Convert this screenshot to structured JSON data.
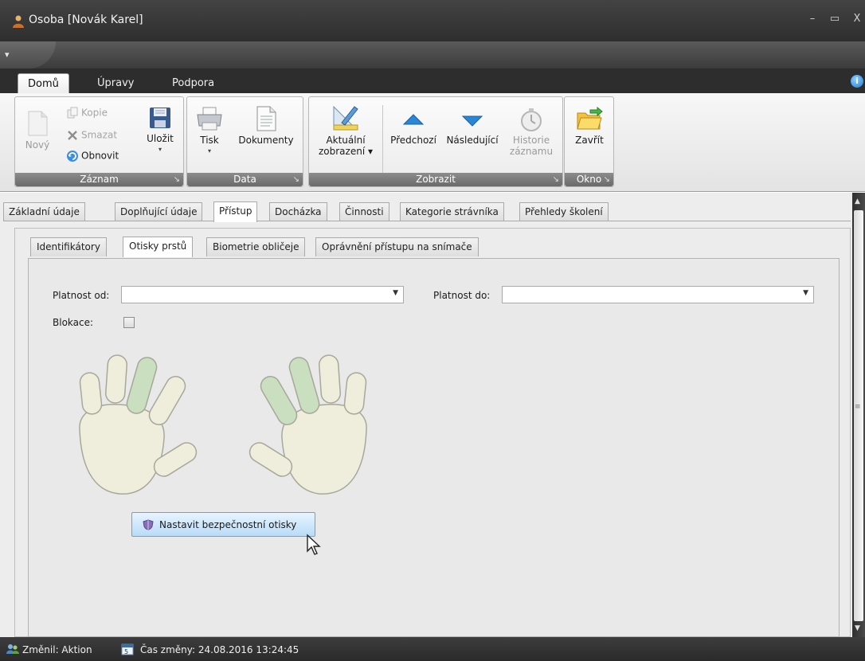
{
  "window": {
    "title": "Osoba [Novák Karel]",
    "minimize": "–",
    "maximize": "▭",
    "close": "X"
  },
  "quick_access": {
    "arrow": "▾"
  },
  "ribbon_tabs": [
    "Domů",
    "Úpravy",
    "Podpora"
  ],
  "info_icon": "i",
  "ribbon": {
    "zaznam": {
      "caption": "Záznam",
      "novy": "Nový",
      "kopie": "Kopie",
      "smazat": "Smazat",
      "obnovit": "Obnovit",
      "ulozit": "Uložit"
    },
    "data": {
      "caption": "Data",
      "tisk": "Tisk",
      "dokumenty": "Dokumenty"
    },
    "zobrazit": {
      "caption": "Zobrazit",
      "aktualni_line1": "Aktuální",
      "aktualni_line2": "zobrazení ▾",
      "predchozi": "Předchozí",
      "nasledujici": "Následující",
      "historie_line1": "Historie",
      "historie_line2": "záznamu"
    },
    "okno": {
      "caption": "Okno",
      "zavrit": "Zavřít"
    },
    "launcher_glyph": "↘"
  },
  "main_tabs": [
    "Základní údaje",
    "Doplňující údaje",
    "Přístup",
    "Docházka",
    "Činnosti",
    "Kategorie strávníka",
    "Přehledy školení"
  ],
  "sub_tabs": [
    "Identifikátory",
    "Otisky prstů",
    "Biometrie obličeje",
    "Oprávnění přístupu na snímače"
  ],
  "form": {
    "platnost_od_label": "Platnost od:",
    "platnost_od_value": "",
    "platnost_do_label": "Platnost do:",
    "platnost_do_value": "",
    "blokace_label": "Blokace:",
    "blokace_checked": false,
    "dropdown_arrow": "▼"
  },
  "fingers": {
    "left_hand_selected": [
      "middle"
    ],
    "right_hand_selected": [
      "index",
      "middle"
    ],
    "colors": {
      "unselected": "#efeedd",
      "selected": "#c9dfc0",
      "outline": "#a8a89a"
    }
  },
  "action_button": {
    "label": "Nastavit bezpečnostní otisky"
  },
  "scrollbar": {
    "up": "▲",
    "down": "▼",
    "grip": "≡"
  },
  "status": {
    "zmenil": "Změnil: Aktion",
    "cas_zmeny": "Čas změny: 24.08.2016 13:24:45"
  }
}
